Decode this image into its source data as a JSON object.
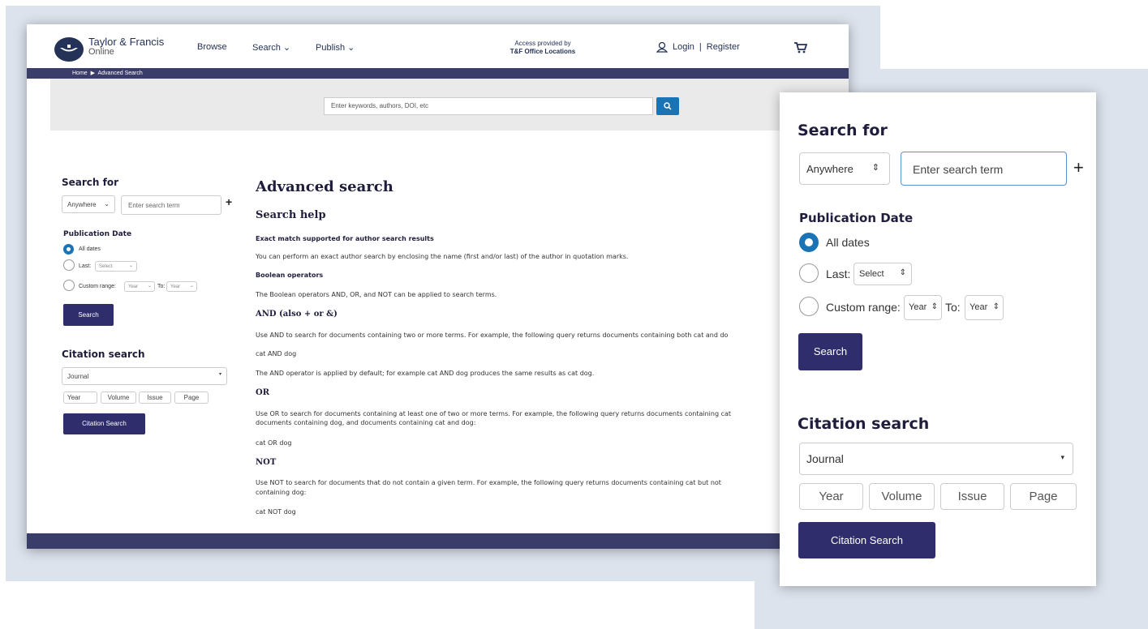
{
  "header": {
    "brand_name": "Taylor & Francis",
    "brand_sub": "Online",
    "nav_browse": "Browse",
    "nav_search": "Search",
    "nav_publish": "Publish",
    "access_line1": "Access provided by",
    "access_line2": "T&F Office Locations",
    "login": "Login",
    "register": "Register"
  },
  "breadcrumb": {
    "home": "Home",
    "current": "Advanced Search"
  },
  "quick_search": {
    "placeholder": "Enter keywords, authors, DOI, etc"
  },
  "left_form": {
    "search_for": "Search for",
    "scope": "Anywhere",
    "term_placeholder": "Enter search term",
    "publication_date": "Publication Date",
    "all_dates": "All dates",
    "last": "Last:",
    "select": "Select",
    "custom_range": "Custom range:",
    "year": "Year",
    "to": "To:",
    "search_button": "Search",
    "citation_search": "Citation search",
    "journal": "Journal",
    "year_field": "Year",
    "volume_field": "Volume",
    "issue_field": "Issue",
    "page_field": "Page",
    "citation_button": "Citation Search"
  },
  "content": {
    "title": "Advanced search",
    "help": "Search help",
    "exact_h": "Exact match supported for author search results",
    "exact_p": "You can perform an exact author search by enclosing the name (first and/or last) of the author in quotation marks.",
    "bool_h": "Boolean operators",
    "bool_p": "The Boolean operators AND, OR, and NOT can be applied to search terms.",
    "and_h": "AND (also + or &)",
    "and_p": "Use AND to search for documents containing two or more terms. For example, the following query returns documents containing both cat and do",
    "and_ex": "cat AND dog",
    "and_p2": "The AND operator is applied by default; for example cat AND dog produces the same results as cat dog.",
    "or_h": "OR",
    "or_p1": "Use OR to search for documents containing at least one of two or more terms. For example, the following query returns documents containing cat",
    "or_p2": "documents containing dog, and documents containing cat and dog:",
    "or_ex": "cat OR dog",
    "not_h": "NOT",
    "not_p1": "Use NOT to search for documents that do not contain a given term. For example, the following query returns documents containing cat but not",
    "not_p2": "containing dog:",
    "not_ex": "cat NOT dog"
  },
  "zoom": {
    "search_for": "Search for",
    "scope": "Anywhere",
    "term_placeholder": "Enter search term",
    "publication_date": "Publication Date",
    "all_dates": "All dates",
    "last": "Last:",
    "select": "Select",
    "custom_range": "Custom range:",
    "year": "Year",
    "to": "To:",
    "search_button": "Search",
    "citation_search": "Citation search",
    "journal": "Journal",
    "year_field": "Year",
    "volume_field": "Volume",
    "issue_field": "Issue",
    "page_field": "Page",
    "citation_button": "Citation Search"
  },
  "colors": {
    "navy": "#2f2d6b",
    "accent_blue": "#1a73b5",
    "bar": "#3a3d69",
    "backdrop": "#dde3ed"
  }
}
